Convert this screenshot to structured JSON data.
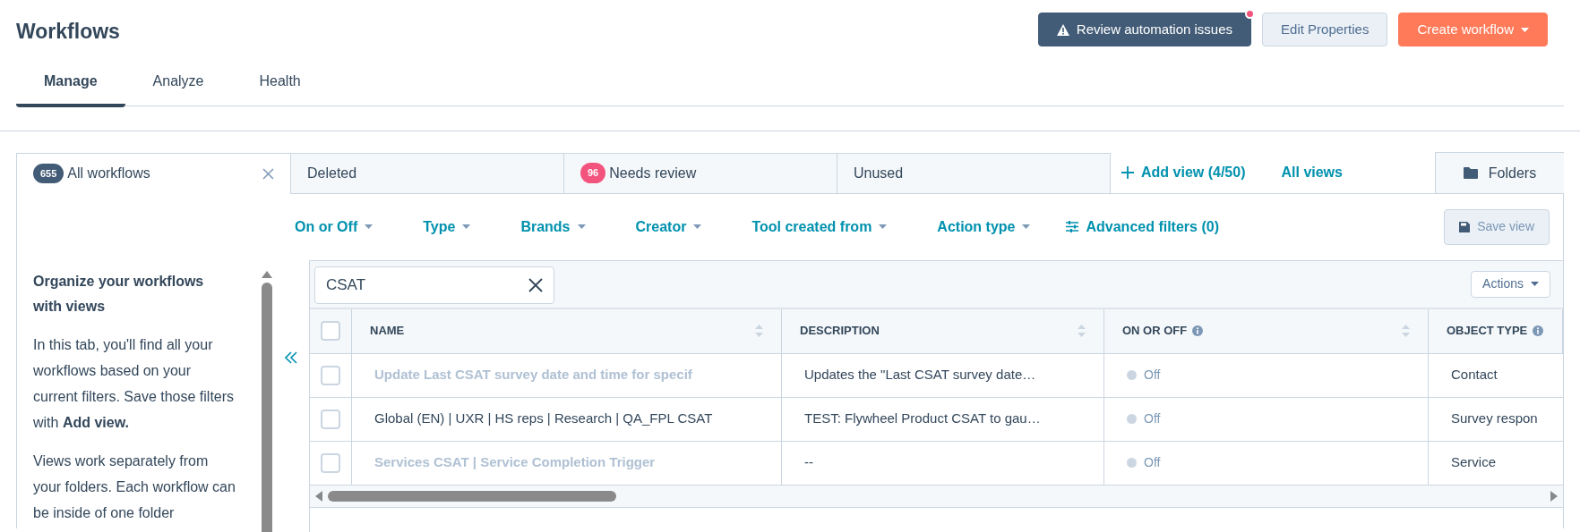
{
  "page": {
    "title": "Workflows"
  },
  "header_buttons": [
    {
      "kind": "dark",
      "label": "Review automation issues",
      "notification": true
    },
    {
      "kind": "light",
      "label": "Edit Properties",
      "notification": false
    },
    {
      "kind": "primary",
      "label": "Create workflow",
      "notification": false
    }
  ],
  "tabs": [
    {
      "label": "Manage",
      "selected": true
    },
    {
      "label": "Analyze",
      "selected": false
    },
    {
      "label": "Health",
      "selected": false
    }
  ],
  "view_tabs": [
    {
      "label": "All workflows",
      "count": "655",
      "color": "#425b76",
      "selected": true,
      "closable": true
    },
    {
      "label": "Deleted",
      "selected": false,
      "closable": false
    },
    {
      "label": "Needs review",
      "count": "96",
      "color": "#f2547d",
      "selected": false,
      "closable": false
    },
    {
      "label": "Unused",
      "selected": false,
      "closable": false
    }
  ],
  "add_view": "Add view (4/50)",
  "all_views": "All views",
  "folders": "Folders",
  "filters": [
    "On or Off",
    "Type",
    "Brands",
    "Creator",
    "Tool created from",
    "Action type"
  ],
  "advanced_filters": "Advanced filters (0)",
  "save_view": "Save view",
  "sidebar": {
    "heading": "Organize your workflows with views",
    "paragraphs": [
      "In this tab, you'll find all your workflows based on your current filters. Save those filters with **Add view.**",
      "Views work separately from your folders. Each workflow can be inside of one folder"
    ]
  },
  "search": {
    "value": "CSAT"
  },
  "actions": "Actions",
  "table": {
    "header_checked": false,
    "columns": [
      {
        "label": "NAME",
        "sortable": true,
        "info": false
      },
      {
        "label": "DESCRIPTION",
        "sortable": true,
        "info": false
      },
      {
        "label": "ON OR OFF",
        "sortable": true,
        "info": true
      },
      {
        "label": "OBJECT TYPE",
        "sortable": false,
        "info": true
      }
    ],
    "rows": [
      {
        "checked": false,
        "name": "Update Last CSAT survey date and time for specif",
        "greyed": true,
        "description": "Updates the \"Last CSAT survey date…",
        "on": false,
        "status": "Off",
        "object_type": "Contact"
      },
      {
        "checked": false,
        "name": "Global (EN) | UXR | HS reps | Research | QA_FPL CSAT",
        "greyed": false,
        "description": "TEST: Flywheel Product CSAT to gau…",
        "on": false,
        "status": "Off",
        "object_type": "Survey respon"
      },
      {
        "checked": false,
        "name": "Services CSAT | Service Completion Trigger",
        "greyed": true,
        "description": "--",
        "on": false,
        "status": "Off",
        "object_type": "Service"
      }
    ]
  }
}
